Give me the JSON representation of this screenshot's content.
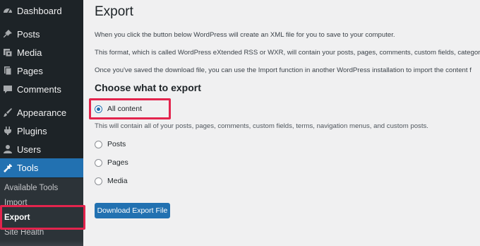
{
  "sidebar": {
    "items": [
      {
        "label": "Dashboard",
        "icon": "dashboard-icon"
      },
      {
        "label": "Posts",
        "icon": "pin-icon"
      },
      {
        "label": "Media",
        "icon": "media-icon"
      },
      {
        "label": "Pages",
        "icon": "pages-icon"
      },
      {
        "label": "Comments",
        "icon": "comments-icon"
      },
      {
        "label": "Appearance",
        "icon": "brush-icon"
      },
      {
        "label": "Plugins",
        "icon": "plugin-icon"
      },
      {
        "label": "Users",
        "icon": "users-icon"
      },
      {
        "label": "Tools",
        "icon": "wrench-icon"
      }
    ],
    "submenu": [
      "Available Tools",
      "Import",
      "Export",
      "Site Health"
    ],
    "active_item": "Tools",
    "current_submenu": "Export"
  },
  "main": {
    "title": "Export",
    "paragraphs": [
      "When you click the button below WordPress will create an XML file for you to save to your computer.",
      "This format, which is called WordPress eXtended RSS or WXR, will contain your posts, pages, comments, custom fields, categori",
      "Once you've saved the download file, you can use the Import function in another WordPress installation to import the content f"
    ],
    "section_title": "Choose what to export",
    "options": [
      {
        "label": "All content",
        "checked": true
      },
      {
        "label": "Posts",
        "checked": false
      },
      {
        "label": "Pages",
        "checked": false
      },
      {
        "label": "Media",
        "checked": false
      }
    ],
    "all_content_description": "This will contain all of your posts, pages, comments, custom fields, terms, navigation menus, and custom posts.",
    "button_label": "Download Export File"
  },
  "colors": {
    "sidebar_bg": "#1d2327",
    "accent": "#2271b1",
    "highlight": "#e3244d",
    "page_bg": "#f0f0f1"
  }
}
